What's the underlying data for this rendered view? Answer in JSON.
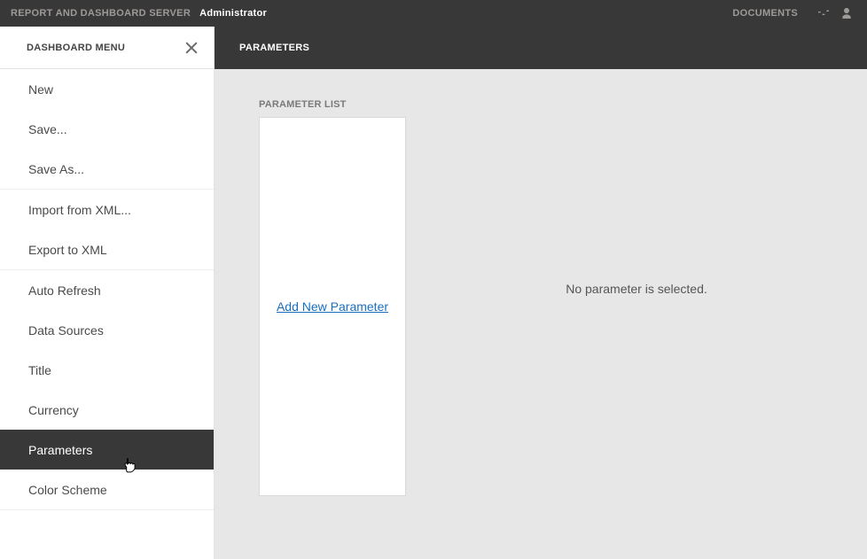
{
  "topbar": {
    "app_title": "REPORT AND DASHBOARD SERVER",
    "role": "Administrator",
    "documents": "DOCUMENTS"
  },
  "sidebar": {
    "title": "DASHBOARD MENU",
    "groups": [
      {
        "items": [
          "New",
          "Save...",
          "Save As..."
        ]
      },
      {
        "items": [
          "Import from XML...",
          "Export to XML"
        ]
      },
      {
        "items": [
          "Auto Refresh",
          "Data Sources",
          "Title",
          "Currency",
          "Parameters",
          "Color Scheme"
        ]
      }
    ],
    "active": "Parameters"
  },
  "main": {
    "header": "PARAMETERS",
    "param_list_label": "PARAMETER LIST",
    "add_link": "Add New Parameter",
    "no_selection": "No parameter is selected."
  }
}
